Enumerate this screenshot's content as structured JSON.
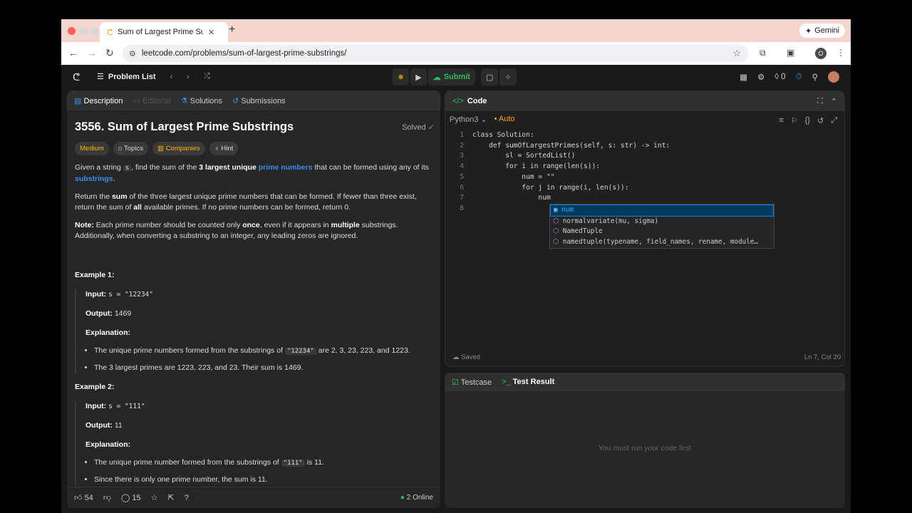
{
  "browser": {
    "tab_title": "Sum of Largest Prime Substrings",
    "url": "leetcode.com/problems/sum-of-largest-prime-substrings/",
    "gemini_label": "Gemini",
    "profile_initial": "O"
  },
  "toolbar": {
    "problem_list": "Problem List",
    "submit": "Submit",
    "notif_count": "0"
  },
  "left_tabs": {
    "description": "Description",
    "editorial": "Editorial",
    "solutions": "Solutions",
    "submissions": "Submissions"
  },
  "problem": {
    "title": "3556. Sum of Largest Prime Substrings",
    "status": "Solved",
    "chips": {
      "difficulty": "Medium",
      "topics": "Topics",
      "companies": "Companies",
      "hint": "Hint"
    },
    "p1": [
      "Given a string ",
      "s",
      ", find the sum of the ",
      "3 largest unique",
      " ",
      "prime numbers",
      " that can be formed using any of its ",
      "substrings",
      "."
    ],
    "p2": [
      "Return the ",
      "sum",
      " of the three largest unique prime numbers that can be formed. If fewer than three exist, return the sum of ",
      "all",
      " available primes. If no prime numbers can be formed, return 0."
    ],
    "p3": [
      "Note:",
      " Each prime number should be counted only ",
      "once",
      ", even if it appears in ",
      "multiple",
      " substrings. Additionally, when converting a substring to an integer, any leading zeros are ignored."
    ],
    "ex1": {
      "title": "Example 1:",
      "input_label": "Input:",
      "input": "s = \"12234\"",
      "output_label": "Output:",
      "output": "1469",
      "expl_label": "Explanation:",
      "b1": [
        "The unique prime numbers formed from the substrings of ",
        "\"12234\"",
        " are 2, 3, 23, 223, and 1223."
      ],
      "b2": "The 3 largest primes are 1223, 223, and 23. Their sum is 1469."
    },
    "ex2": {
      "title": "Example 2:",
      "input_label": "Input:",
      "input": "s = \"111\"",
      "output_label": "Output:",
      "output": "11",
      "expl_label": "Explanation:",
      "b1": [
        "The unique prime number formed from the substrings of ",
        "\"111\"",
        " is 11."
      ],
      "b2": "Since there is only one prime number, the sum is 11."
    }
  },
  "footer": {
    "likes": "54",
    "comments": "15",
    "online": "2 Online"
  },
  "code": {
    "header": "Code",
    "language": "Python3",
    "mode": "Auto",
    "saved": "Saved",
    "cursor": "Ln 7, Col 20",
    "line_numbers": [
      "1",
      "2",
      "3",
      "4",
      "5",
      "6",
      "7",
      "8"
    ],
    "lines": [
      "class Solution:",
      "    def sumOfLargestPrimes(self, s: str) -> int:",
      "        sl = SortedList()",
      "        for i in range(len(s)):",
      "            num = \"\"",
      "            for j in range(i, len(s)):",
      "                num",
      ""
    ]
  },
  "suggestions": [
    "num",
    "normalvariate(mu, sigma)",
    "NamedTuple",
    "namedtuple(typename, field_names, rename, module…"
  ],
  "test": {
    "testcase": "Testcase",
    "result": "Test Result",
    "empty": "You must run your code first"
  }
}
